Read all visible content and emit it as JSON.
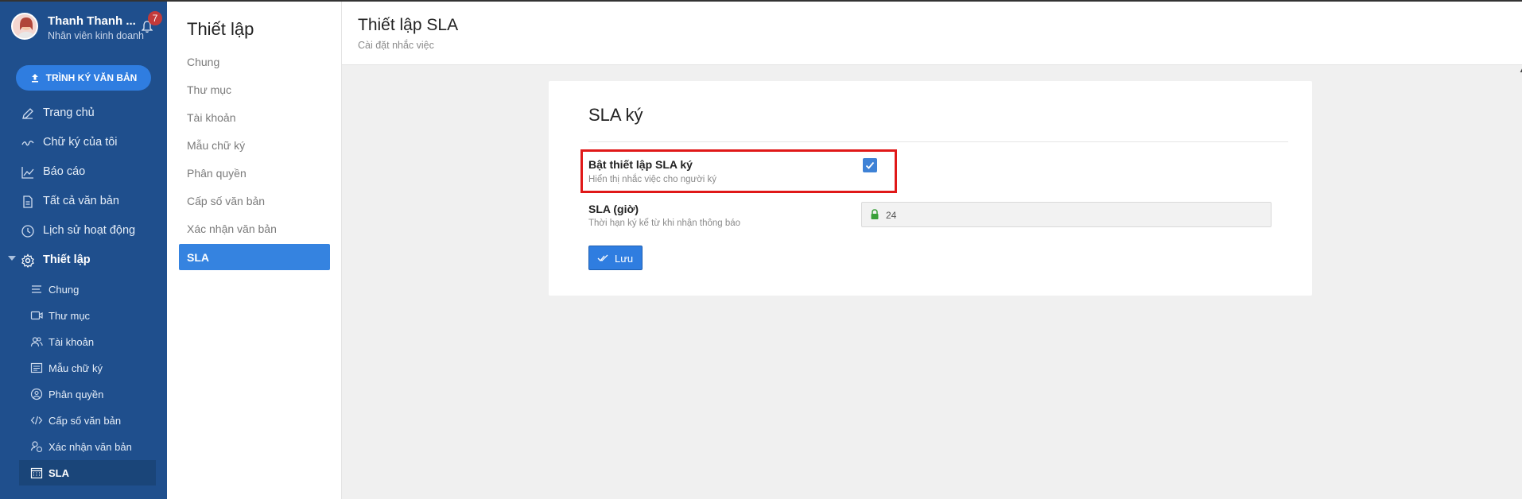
{
  "user": {
    "name": "Thanh Thanh ...",
    "role": "Nhân viên kinh doanh",
    "notification_count": "7"
  },
  "sidebar": {
    "sign_button": "TRÌNH KÝ VĂN BẢN",
    "items": [
      {
        "label": "Trang chủ",
        "icon": "pen-icon"
      },
      {
        "label": "Chữ ký của tôi",
        "icon": "signature-icon"
      },
      {
        "label": "Báo cáo",
        "icon": "chart-icon"
      },
      {
        "label": "Tất cả văn bản",
        "icon": "document-icon"
      },
      {
        "label": "Lịch sử hoạt động",
        "icon": "clock-icon"
      },
      {
        "label": "Thiết lập",
        "icon": "gear-icon"
      }
    ],
    "sub_items": [
      {
        "label": "Chung",
        "icon": "lines-icon"
      },
      {
        "label": "Thư mục",
        "icon": "video-icon"
      },
      {
        "label": "Tài khoản",
        "icon": "users-icon"
      },
      {
        "label": "Mẫu chữ ký",
        "icon": "template-icon"
      },
      {
        "label": "Phân quyền",
        "icon": "user-circle-icon"
      },
      {
        "label": "Cấp số văn bản",
        "icon": "code-icon"
      },
      {
        "label": "Xác nhận văn bản",
        "icon": "user-check-icon"
      },
      {
        "label": "SLA",
        "icon": "calendar-icon"
      }
    ]
  },
  "settings_menu": {
    "title": "Thiết lập",
    "items": [
      "Chung",
      "Thư mục",
      "Tài khoản",
      "Mẫu chữ ký",
      "Phân quyền",
      "Cấp số văn bản",
      "Xác nhận văn bản",
      "SLA"
    ]
  },
  "header": {
    "title": "Thiết lập SLA",
    "subtitle": "Cài đặt nhắc việc"
  },
  "card": {
    "title": "SLA ký",
    "enable": {
      "label": "Bật thiết lập SLA ký",
      "desc": "Hiển thị nhắc việc cho người ký",
      "checked": true
    },
    "sla": {
      "label": "SLA (giờ)",
      "desc": "Thời hạn ký kể từ khi nhận thông báo",
      "value": "24"
    },
    "save_label": "Lưu"
  },
  "colors": {
    "sidebar": "#1f4f8d",
    "accent": "#2f7de0",
    "highlight": "#e01818"
  }
}
